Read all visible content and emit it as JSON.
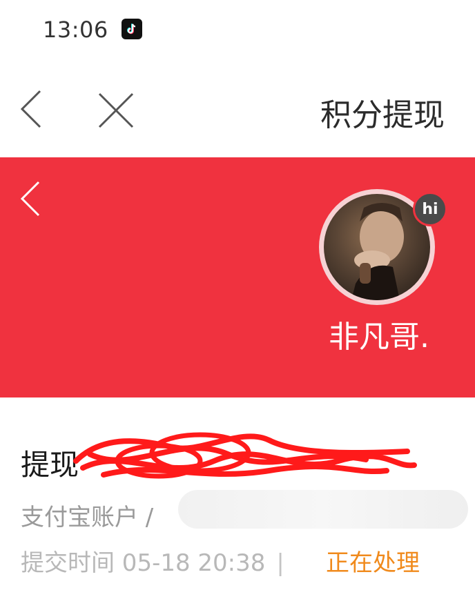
{
  "status_bar": {
    "time": "13:06",
    "app_icon": "tiktok-icon"
  },
  "nav": {
    "back_icon": "chevron-left-icon",
    "close_icon": "close-icon",
    "title": "积分提现"
  },
  "hero": {
    "back_icon": "chevron-left-icon",
    "avatar_badge": "hi",
    "username": "非凡哥.",
    "background_color": "#f0323f"
  },
  "record": {
    "title": "提现",
    "account_label": "支付宝账户 /",
    "time_label": "提交时间 05-18 20:38",
    "separator": "|",
    "status": "正在处理",
    "status_color": "#f08a1c"
  }
}
